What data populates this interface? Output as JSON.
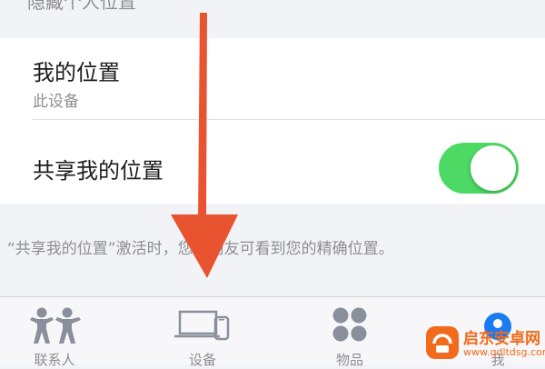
{
  "section_header": "隐藏个人位置",
  "my_location": {
    "title": "我的位置",
    "subtitle": "此设备"
  },
  "share_location": {
    "label": "共享我的位置",
    "enabled": true
  },
  "footnote": "“共享我的位置”激活时，您的朋友可看到您的精确位置。",
  "tabbar": {
    "tabs": [
      {
        "label": "联系人",
        "icon": "people-icon"
      },
      {
        "label": "设备",
        "icon": "devices-icon"
      },
      {
        "label": "物品",
        "icon": "grid-dots-icon"
      },
      {
        "label": "我",
        "icon": "person-circle-icon"
      }
    ]
  },
  "overlay": {
    "arrow": "down-arrow",
    "arrow_color": "#e8542f"
  },
  "watermark": {
    "name": "启东安卓网",
    "url": "www.qdltdsg.com"
  },
  "colors": {
    "toggle_on": "#4cd964",
    "secondary_text": "#8e8e93",
    "tab_icon": "#8a8f9c",
    "watermark": "#f26a1b"
  }
}
